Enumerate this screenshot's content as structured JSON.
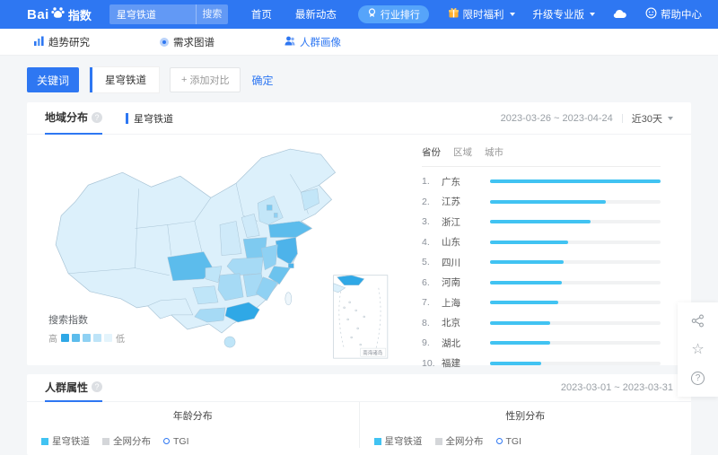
{
  "navbar": {
    "logo": {
      "bai": "Bai",
      "suffix": "指数"
    },
    "search": {
      "value": "星穹铁道",
      "button_label": "搜索"
    },
    "links": [
      "首页",
      "最新动态"
    ],
    "industry_rank": "行业排行",
    "promo": "限时福利",
    "upgrade": "升级专业版",
    "help_center": "帮助中心"
  },
  "subnav": {
    "tabs": [
      {
        "label": "趋势研究"
      },
      {
        "label": "需求图谱"
      },
      {
        "label": "人群画像"
      }
    ]
  },
  "keyword_bar": {
    "label": "关键词",
    "keyword": "星穹铁道",
    "add_plus": "+",
    "add_compare": "添加对比",
    "confirm": "确定"
  },
  "region": {
    "title": "地域分布",
    "help": "?",
    "series": "星穹铁道",
    "date_range": "2023-03-26 ~ 2023-04-24",
    "period": "近30天",
    "tabs": [
      {
        "label": "省份",
        "active": true
      },
      {
        "label": "区域",
        "active": false
      },
      {
        "label": "城市",
        "active": false
      }
    ],
    "map_legend": {
      "title": "搜索指数",
      "high": "高",
      "low": "低",
      "colors": [
        "#2fa8e6",
        "#5cbcec",
        "#8fd1f3",
        "#bee4f8",
        "#e4f4fc"
      ]
    },
    "inset_label": "南海诸岛",
    "ranking": [
      {
        "rank": "1.",
        "name": "广东",
        "value": 100
      },
      {
        "rank": "2.",
        "name": "江苏",
        "value": 68
      },
      {
        "rank": "3.",
        "name": "浙江",
        "value": 59
      },
      {
        "rank": "4.",
        "name": "山东",
        "value": 46
      },
      {
        "rank": "5.",
        "name": "四川",
        "value": 43
      },
      {
        "rank": "6.",
        "name": "河南",
        "value": 42
      },
      {
        "rank": "7.",
        "name": "上海",
        "value": 40
      },
      {
        "rank": "8.",
        "name": "北京",
        "value": 35
      },
      {
        "rank": "9.",
        "name": "湖北",
        "value": 35
      },
      {
        "rank": "10.",
        "name": "福建",
        "value": 30
      }
    ],
    "bar_color": "#41c3f2"
  },
  "demographics": {
    "title": "人群属性",
    "help": "?",
    "date_range": "2023-03-01 ~ 2023-03-31",
    "panels": [
      {
        "title": "年龄分布"
      },
      {
        "title": "性别分布"
      }
    ],
    "legend": [
      {
        "label": "星穹铁道",
        "type": "square",
        "color": "#41c3f2"
      },
      {
        "label": "全网分布",
        "type": "square",
        "color": "#d4d6d9"
      },
      {
        "label": "TGI",
        "type": "ring",
        "color": "#2e77f2"
      }
    ]
  },
  "colors": {
    "navbar_blue": "#2e77f2",
    "bar_cyan": "#41c3f2",
    "page_bg": "#f4f6f8"
  }
}
